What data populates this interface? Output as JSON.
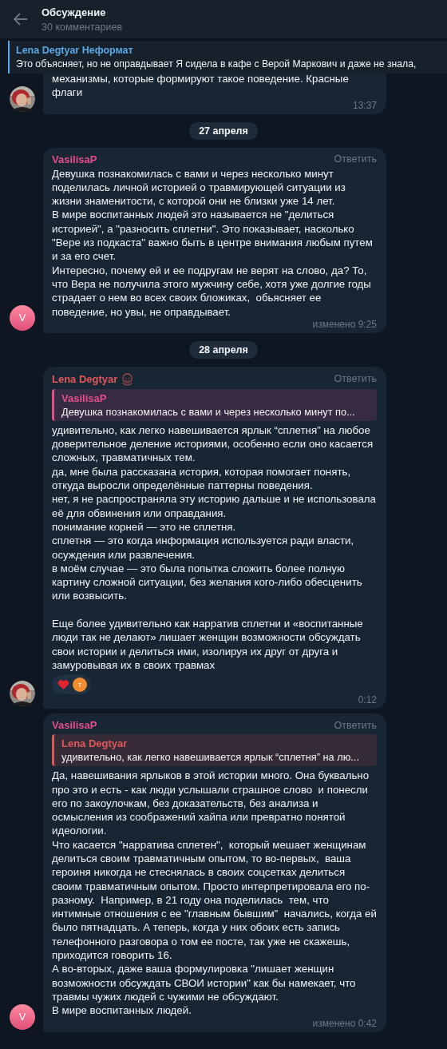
{
  "header": {
    "title": "Обсуждение",
    "subtitle": "30 комментариев"
  },
  "pinned": {
    "title": "Lena Degtyar Неформат",
    "text": "Это объясняет, но не оправдывает  Я сидела в кафе с Верой Маркович и даже не знала,"
  },
  "feed": [
    {
      "kind": "message",
      "text": "механизмы, которые формируют такое поведение. Красные\nфлаги",
      "time": "13:37"
    },
    {
      "kind": "date",
      "text": "27 апреля"
    },
    {
      "kind": "message",
      "author": "VasilisaP",
      "color": "#e5508a",
      "reply": "Ответить",
      "text": "Девушка познакомилась с вами и через несколько минут поделилась личной историей о травмирующей ситуации из жизни знаменитости, с которой они не близки уже 14 лет.\nВ мире воспитанных людей это называется не \"делиться историей\", а \"разносить сплетни\". Это показывает, насколько \"Вере из подкаста\" важно быть в центре внимания любым путем и за его счет.\nИнтересно, почему ей и ее подругам не верят на слово, да? То, что Вера не получила этого мужчину себе, хотя уже долгие годы страдает о нем во всех своих бложиках,  обьясняет ее поведение, но увы, не оправдывает.",
      "time": "изменено 9:25",
      "avatar": {
        "kind": "initial",
        "initial": "V"
      }
    },
    {
      "kind": "date",
      "text": "28 апреля"
    },
    {
      "kind": "message",
      "author": "Lena Degtyar",
      "color": "#e0585a",
      "status_emoji": true,
      "reply": "Ответить",
      "quote": {
        "author": "VasilisaP",
        "color": "#e5508a",
        "text": "Девушка познакомилась с вами и через несколько минут по..."
      },
      "text": "удивительно, как легко навешивается ярлык “сплетня” на любое доверительное деление историями, особенно если оно касается сложных, травматичных тем.\nда, мне была рассказана история, которая помогает понять, откуда выросли определённые паттерны поведения.\nнет, я не распространяла эту историю дальше и не использовала её для обвинения или оправдания.\nпонимание корней — это не сплетня.\nсплетня — это когда информация используется ради власти, осуждения или развлечения.\nв моём случае — это была попытка сложить более полную картину сложной ситуации, без желания кого-либо обесценить или возвысить.\n\nЕще более удивительно как нарратив сплетни и «воспитанные люди так не делают» лишает женщин возможности обсуждать свои истории и делиться ими, изолируя их друг от друга и замуровывая их в своих травмах",
      "reactions": [
        {
          "kind": "heart"
        },
        {
          "kind": "user",
          "initial": "т"
        }
      ],
      "time": "0:12"
    },
    {
      "kind": "message",
      "author": "VasilisaP",
      "color": "#e5508a",
      "reply": "Ответить",
      "quote": {
        "author": "Lena Degtyar",
        "color": "#e0585a",
        "text": "удивительно, как легко навешивается ярлык “сплетня” на лю..."
      },
      "text": "Да, навешивания ярлыков в этой истории много. Она буквально про это и есть - как люди услышали страшное слово  и понесли его по закоулочкам, без доказательств, без анализа и осмысления из соображений хайпа или превратно понятой идеологии.\nЧто касается \"нарратива сплетен\",  который мешает женщинам делиться своим травматичным опытом, то во-первых,  ваша героиня никогда не стеснялась в своих соцсетках делиться своим травматичным опытом. Просто интерпретировала его по-разному.  Например, в 21 году она поделилась  тем, что интимные отношения с ее \"главным бывшим\"  начались, когда ей было пятнадцать. А теперь, когда у них обоих есть запись телефонного разговора о том ее посте, так уже не скажешь, приходится говорить 16.\nА во-вторых, даже ваша формулировка \"лишает женщин возможности обсуждать СВОИ истории\" как бы намекает, что травмы чужих людей с чужими не обсуждают.\nВ мире воспитанных людей.",
      "time": "изменено 0:42",
      "avatar": {
        "kind": "initial",
        "initial": "V"
      }
    }
  ]
}
